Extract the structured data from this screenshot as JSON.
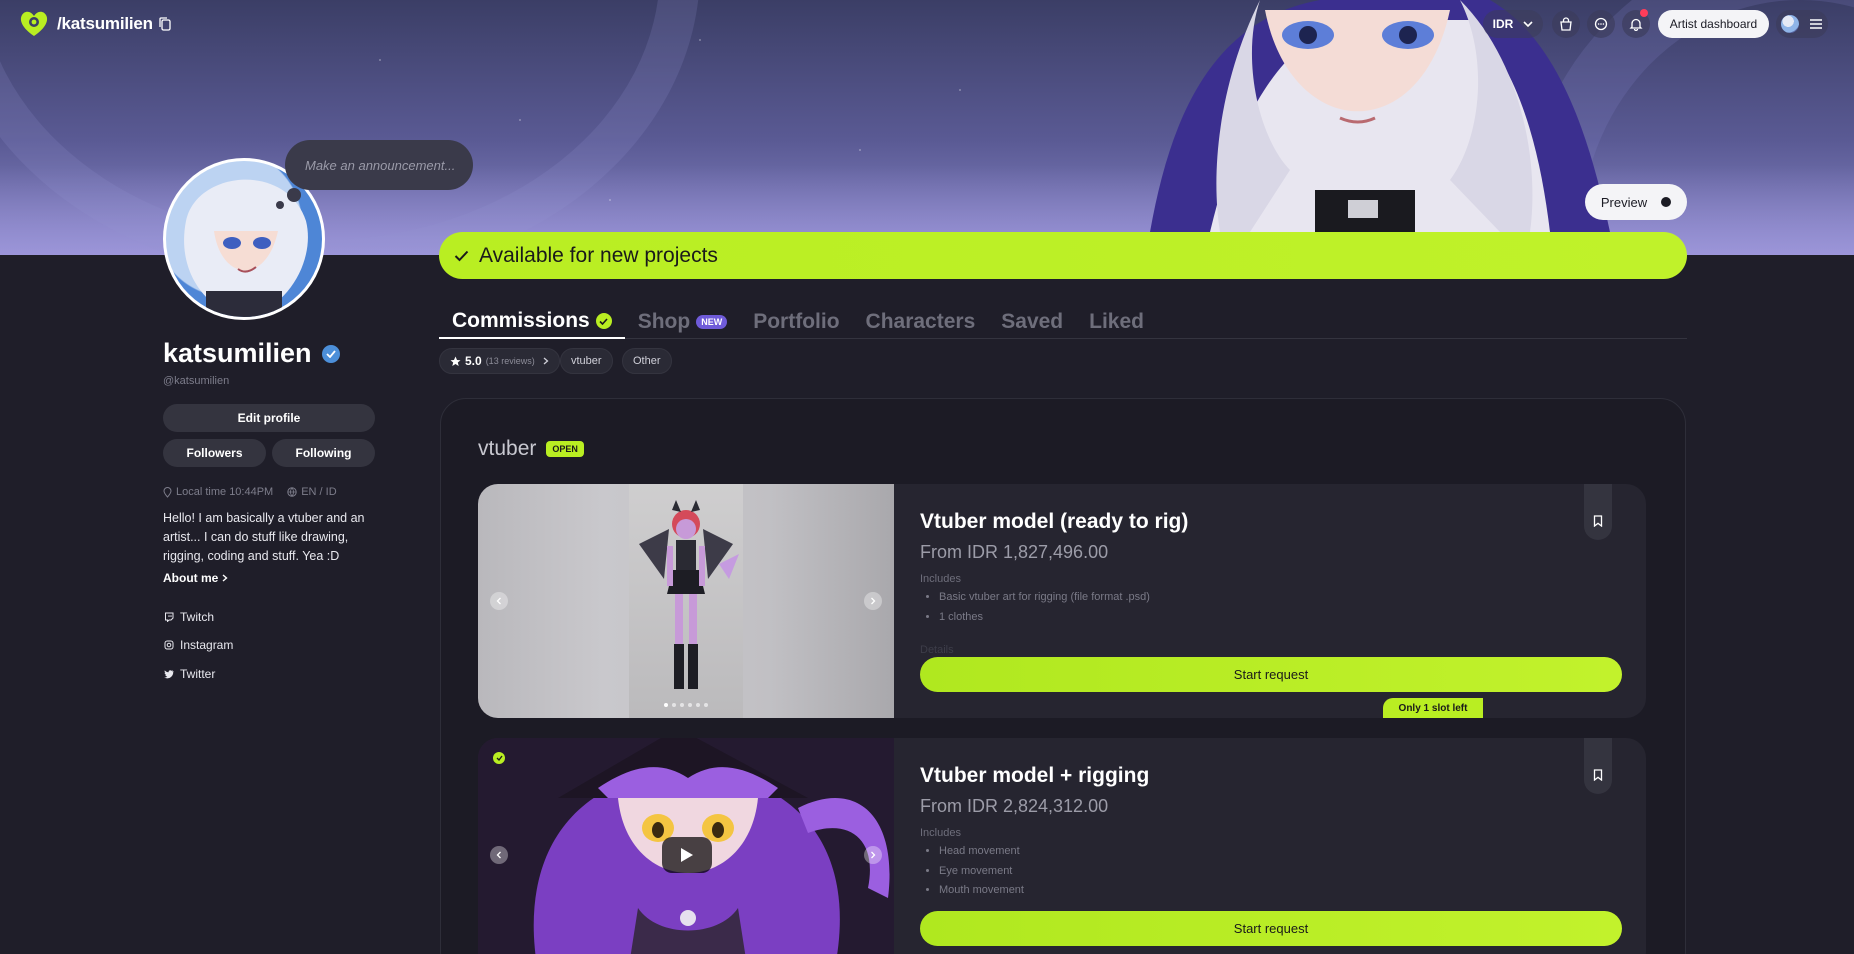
{
  "topnav": {
    "handle": "/katsumilien",
    "currency": "IDR",
    "artist_dashboard": "Artist dashboard"
  },
  "profile": {
    "announcement_placeholder": "Make an announcement...",
    "display_name": "katsumilien",
    "handle": "@katsumilien",
    "edit_profile": "Edit profile",
    "followers": "Followers",
    "following": "Following",
    "local_time": "Local time 10:44PM",
    "languages": "EN / ID",
    "bio": "Hello! I am basically a vtuber and an artist... I can do stuff like drawing, rigging, coding and stuff. Yea :D",
    "about_me": "About me",
    "socials": [
      "Twitch",
      "Instagram",
      "Twitter"
    ]
  },
  "preview_label": "Preview",
  "availability": "Available for new projects",
  "tabs": {
    "commissions": "Commissions",
    "shop": "Shop",
    "shop_badge": "NEW",
    "portfolio": "Portfolio",
    "characters": "Characters",
    "saved": "Saved",
    "liked": "Liked"
  },
  "filters": {
    "rating": "5.0",
    "reviews": "(13 reviews)",
    "tag1": "vtuber",
    "tag2": "Other"
  },
  "section": {
    "title": "vtuber",
    "status": "OPEN"
  },
  "commissions": [
    {
      "title": "Vtuber model (ready to rig)",
      "price": "From IDR 1,827,496.00",
      "includes_label": "Includes",
      "includes": [
        "Basic vtuber art for rigging (file format .psd)",
        "1 clothes"
      ],
      "details_label": "Details",
      "cta": "Start request",
      "slots": "Only 1 slot left"
    },
    {
      "title": "Vtuber model + rigging",
      "price": "From IDR 2,824,312.00",
      "includes_label": "Includes",
      "includes": [
        "Head movement",
        "Eye movement",
        "Mouth movement"
      ],
      "cta": "Start request"
    }
  ],
  "colors": {
    "accent": "#b9ee22",
    "background": "#1f1e29",
    "card": "#262530",
    "new_badge": "#6f5bd9",
    "verified": "#4c8fd9"
  }
}
